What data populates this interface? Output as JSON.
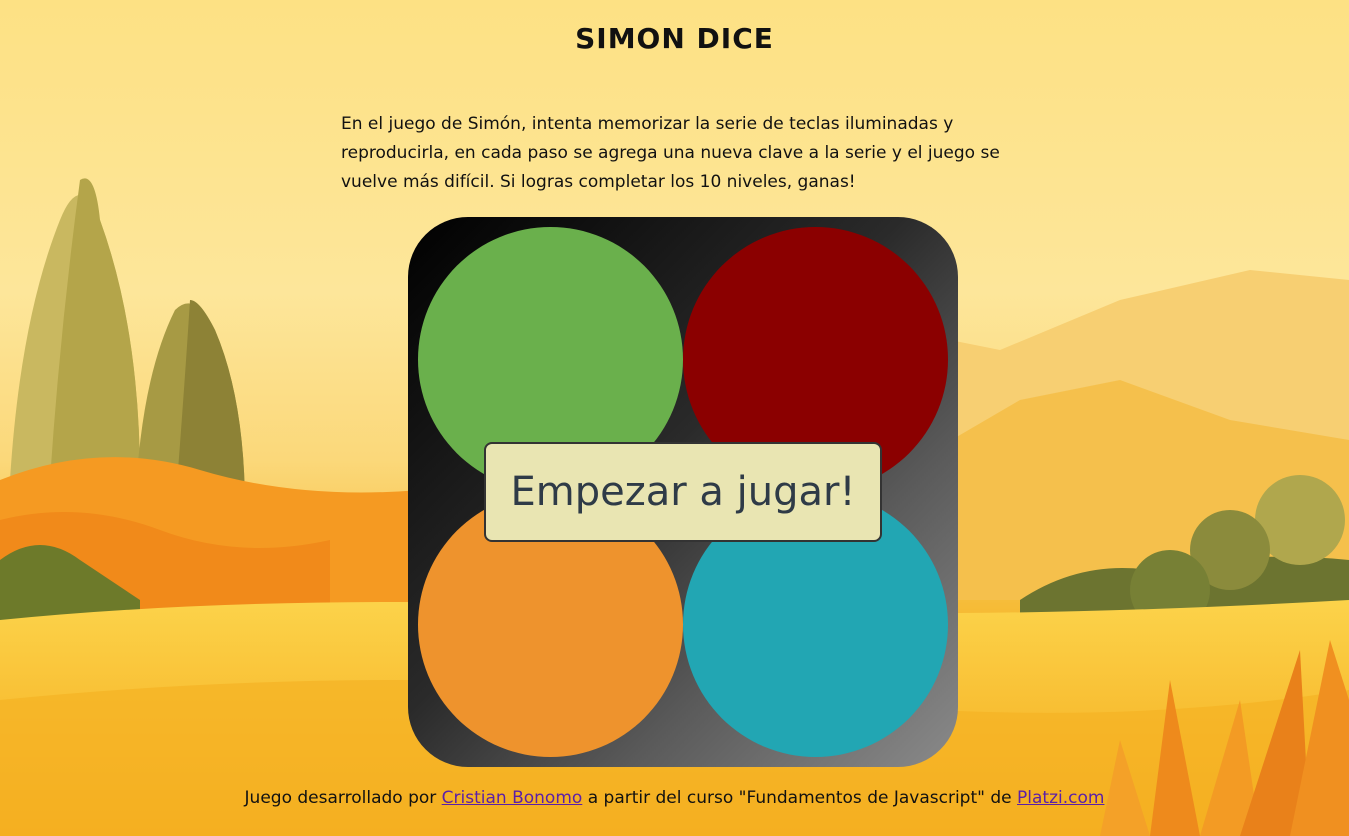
{
  "title": "SIMON DICE",
  "description": "En el juego de Simón, intenta memorizar la serie de teclas iluminadas y reproducirla, en cada paso se agrega una nueva clave a la serie y el juego se vuelve más difícil. Si logras completar los 10 niveles, ganas!",
  "keys": [
    {
      "name": "green",
      "color": "#6ab04c"
    },
    {
      "name": "red",
      "color": "#8b0000"
    },
    {
      "name": "orange",
      "color": "#ee932d"
    },
    {
      "name": "blue",
      "color": "#22a6b3"
    }
  ],
  "start_button": "Empezar a jugar!",
  "footer": {
    "prefix": "Juego desarrollado por ",
    "author_link": "Cristian Bonomo",
    "middle": " a partir del curso \"Fundamentos de Javascript\" de ",
    "site_link": "Platzi.com"
  }
}
